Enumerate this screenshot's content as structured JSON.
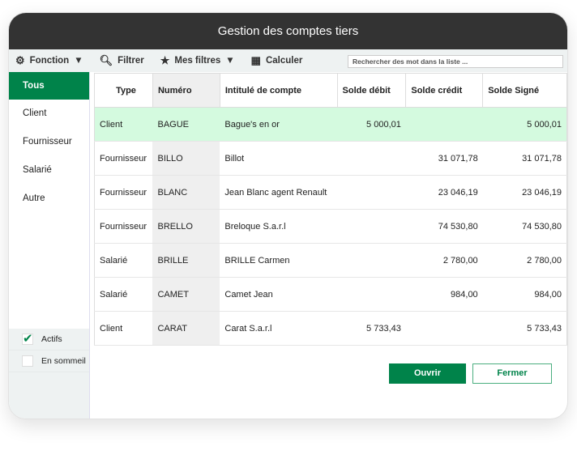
{
  "title": "Gestion des comptes tiers",
  "toolbar": {
    "fonction": "Fonction",
    "filtrer": "Filtrer",
    "mes_filtres": "Mes filtres",
    "calculer": "Calculer",
    "search_placeholder": "Rechercher des mot dans la liste ..."
  },
  "sidebar": {
    "items": [
      "Tous",
      "Client",
      "Fournisseur",
      "Salarié",
      "Autre"
    ],
    "checks": [
      {
        "label": "Actifs",
        "checked": true
      },
      {
        "label": "En sommeil",
        "checked": false
      }
    ]
  },
  "table": {
    "headers": [
      "Type",
      "Numéro",
      "Intitulé de compte",
      "Solde débit",
      "Solde crédit",
      "Solde Signé"
    ],
    "rows": [
      [
        "Client",
        "BAGUE",
        "Bague's en or",
        "5 000,01",
        "",
        "5 000,01"
      ],
      [
        "Fournisseur",
        "BILLO",
        "Billot",
        "",
        "31 071,78",
        "31 071,78"
      ],
      [
        "Fournisseur",
        "BLANC",
        "Jean Blanc agent Renault",
        "",
        "23 046,19",
        "23 046,19"
      ],
      [
        "Fournisseur",
        "BRELLO",
        "Breloque S.a.r.l",
        "",
        "74 530,80",
        "74 530,80"
      ],
      [
        "Salarié",
        "BRILLE",
        "BRILLE Carmen",
        "",
        "2 780,00",
        "2 780,00"
      ],
      [
        "Salarié",
        "CAMET",
        "Camet Jean",
        "",
        "984,00",
        "984,00"
      ],
      [
        "Client",
        "CARAT",
        "Carat S.a.r.l",
        "5 733,43",
        "",
        "5 733,43"
      ]
    ]
  },
  "buttons": {
    "ok": "Ouvrir",
    "close": "Fermer"
  },
  "colors": {
    "accent": "#00834a",
    "selected_row": "#d4fadf",
    "titlebar": "#333333"
  }
}
